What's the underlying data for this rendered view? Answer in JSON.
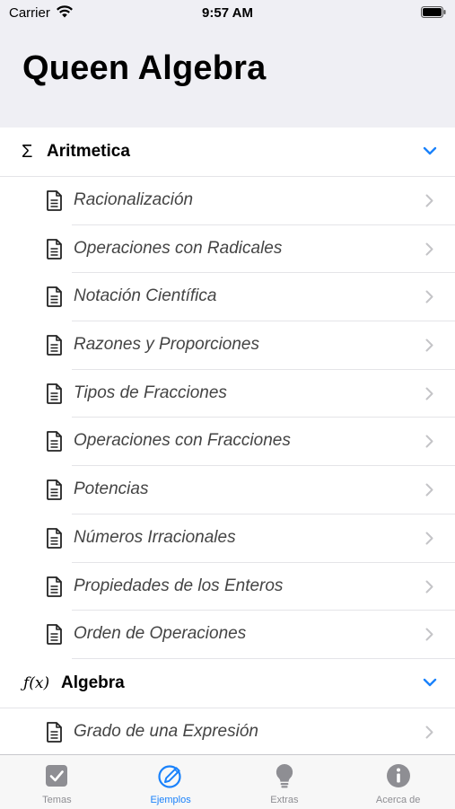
{
  "status_bar": {
    "carrier": "Carrier",
    "time": "9:57 AM"
  },
  "page": {
    "title": "Queen Algebra"
  },
  "sections": [
    {
      "symbol": "Σ",
      "title": "Aritmetica",
      "items": [
        "Racionalización",
        "Operaciones con Radicales",
        "Notación Científica",
        "Razones y Proporciones",
        "Tipos de Fracciones",
        "Operaciones con Fracciones",
        "Potencias",
        "Números Irracionales",
        "Propiedades de los Enteros",
        "Orden de Operaciones"
      ]
    },
    {
      "symbol": "ƒ(x)",
      "title": "Algebra",
      "items": [
        "Grado de una Expresión"
      ]
    }
  ],
  "tab_bar": {
    "tabs": [
      {
        "label": "Temas",
        "icon": "checkbox-icon"
      },
      {
        "label": "Ejemplos",
        "icon": "pencil-circle-icon"
      },
      {
        "label": "Extras",
        "icon": "lightbulb-icon"
      },
      {
        "label": "Acerca de",
        "icon": "info-icon"
      }
    ],
    "active_index": 1
  },
  "colors": {
    "accent": "#1a82fb",
    "inactive": "#8e8e93",
    "header_bg": "#efeff4"
  }
}
